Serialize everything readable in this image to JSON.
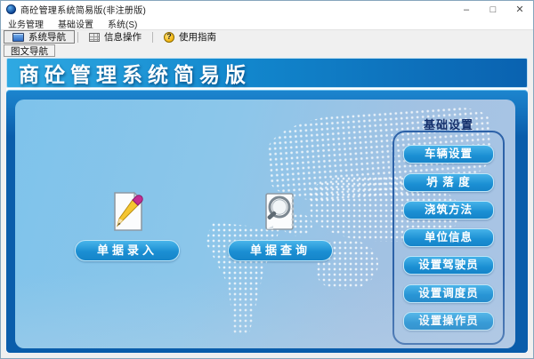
{
  "window": {
    "title": "商砼管理系统简易版(非注册版)",
    "controls": {
      "minimize": "–",
      "maximize": "□",
      "close": "✕"
    }
  },
  "menu": {
    "items": [
      {
        "label": "业务管理"
      },
      {
        "label": "基础设置"
      },
      {
        "label": "系统(S)"
      }
    ]
  },
  "toolbar": {
    "items": [
      {
        "label": "系统导航",
        "icon": "navigation-icon",
        "active": true
      },
      {
        "label": "信息操作",
        "icon": "grid-icon",
        "active": false
      },
      {
        "label": "使用指南",
        "icon": "help-icon",
        "active": false
      }
    ],
    "help_glyph": "?"
  },
  "tabs": {
    "items": [
      {
        "label": "图文导航"
      }
    ]
  },
  "banner": {
    "title": "商砼管理系统简易版"
  },
  "main": {
    "shortcuts": [
      {
        "label": "单据录入",
        "icon": "pencil-document-icon"
      },
      {
        "label": "单据查询",
        "icon": "search-document-icon"
      }
    ],
    "settings_panel": {
      "title": "基础设置",
      "buttons": [
        {
          "label": "车辆设置"
        },
        {
          "label": "坍 落 度"
        },
        {
          "label": "浇筑方法"
        },
        {
          "label": "单位信息"
        },
        {
          "label": "设置驾驶员"
        },
        {
          "label": "设置调度员"
        },
        {
          "label": "设置操作员"
        }
      ]
    }
  },
  "colors": {
    "banner_start": "#2fa9e2",
    "banner_end": "#0a62b0",
    "frame": "#0a5dab",
    "canvas_left": "#7ec3eb",
    "canvas_right": "#abc5e4",
    "button": "#1b8fd3",
    "panel_border": "#2d62a8",
    "panel_title_text": "#142f6b"
  }
}
